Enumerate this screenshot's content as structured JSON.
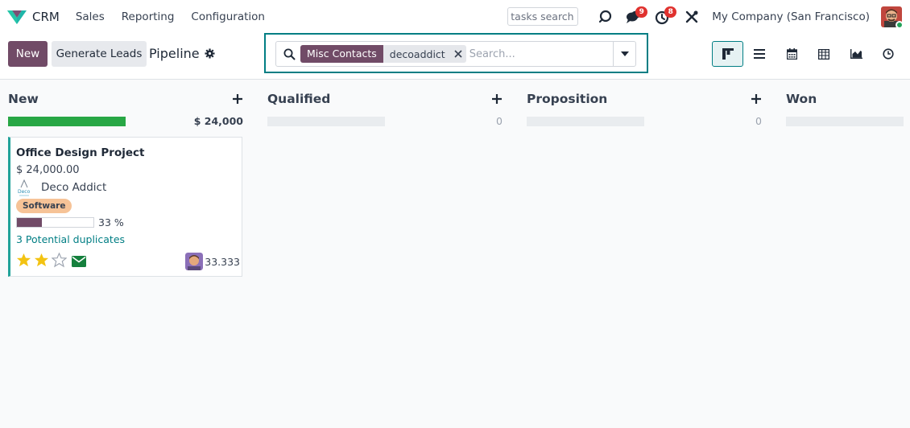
{
  "navbar": {
    "app_name": "CRM",
    "menu": [
      "Sales",
      "Reporting",
      "Configuration"
    ],
    "tasks_search_placeholder": "tasks search",
    "messages_count": "9",
    "activities_count": "8",
    "company": "My Company (San Francisco)"
  },
  "control_panel": {
    "new_label": "New",
    "generate_leads_label": "Generate Leads",
    "breadcrumb": "Pipeline",
    "search": {
      "facet_label": "Misc Contacts",
      "facet_value": "decoaddict",
      "placeholder": "Search..."
    },
    "views": [
      "kanban-view-icon",
      "list-view-icon",
      "calendar-view-icon",
      "pivot-view-icon",
      "graph-view-icon",
      "activity-view-icon"
    ],
    "active_view": "kanban"
  },
  "colors": {
    "primary": "#714b67",
    "accent": "#017e84",
    "success": "#28a745",
    "tag": "#f6c397",
    "badge": "#e0322f"
  },
  "columns": [
    {
      "title": "New",
      "total": "$ 24,000",
      "progress": 1.0
    },
    {
      "title": "Qualified",
      "total": "0",
      "progress": 0
    },
    {
      "title": "Proposition",
      "total": "0",
      "progress": 0
    },
    {
      "title": "Won",
      "total": "",
      "progress": 0
    }
  ],
  "card": {
    "title": "Office Design Project",
    "amount": "$ 24,000.00",
    "partner": "Deco Addict",
    "partner_logo_text": "Deco",
    "tag": "Software",
    "probability_text": "33 %",
    "probability": 0.33,
    "duplicates": "3 Potential duplicates",
    "priority": 2,
    "priority_max": 3,
    "assignee_value": "33.333"
  }
}
